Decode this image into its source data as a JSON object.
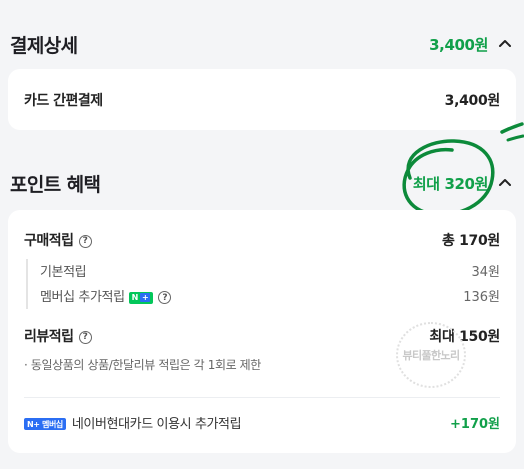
{
  "payment": {
    "title": "결제상세",
    "total": "3,400원",
    "method_label": "카드 간편결제",
    "method_amount": "3,400원"
  },
  "points": {
    "title": "포인트 혜택",
    "max_label": "최대 320원",
    "purchase": {
      "label": "구매적립",
      "help": "?",
      "total": "총 170원",
      "items": [
        {
          "label": "기본적립",
          "amount": "34원"
        },
        {
          "label": "멤버십 추가적립",
          "amount": "136원",
          "badge": "N+"
        }
      ]
    },
    "review": {
      "label": "리뷰적립",
      "help": "?",
      "amount": "최대 150원",
      "note": "· 동일상품의 상품/한달리뷰 적립은 각 1회로 제한"
    },
    "naver_card": {
      "badge": "N+ 멤버십",
      "label": "네이버현대카드 이용시 추가적립",
      "amount": "+170원"
    }
  },
  "watermark": "뷰티풀한노리",
  "colors": {
    "accent_green": "#11a04a",
    "annotation_green": "#0c8a3a",
    "naver_green": "#03c75a"
  },
  "icons": [
    "chevron-up-icon",
    "help-icon",
    "naver-plus-badge"
  ]
}
